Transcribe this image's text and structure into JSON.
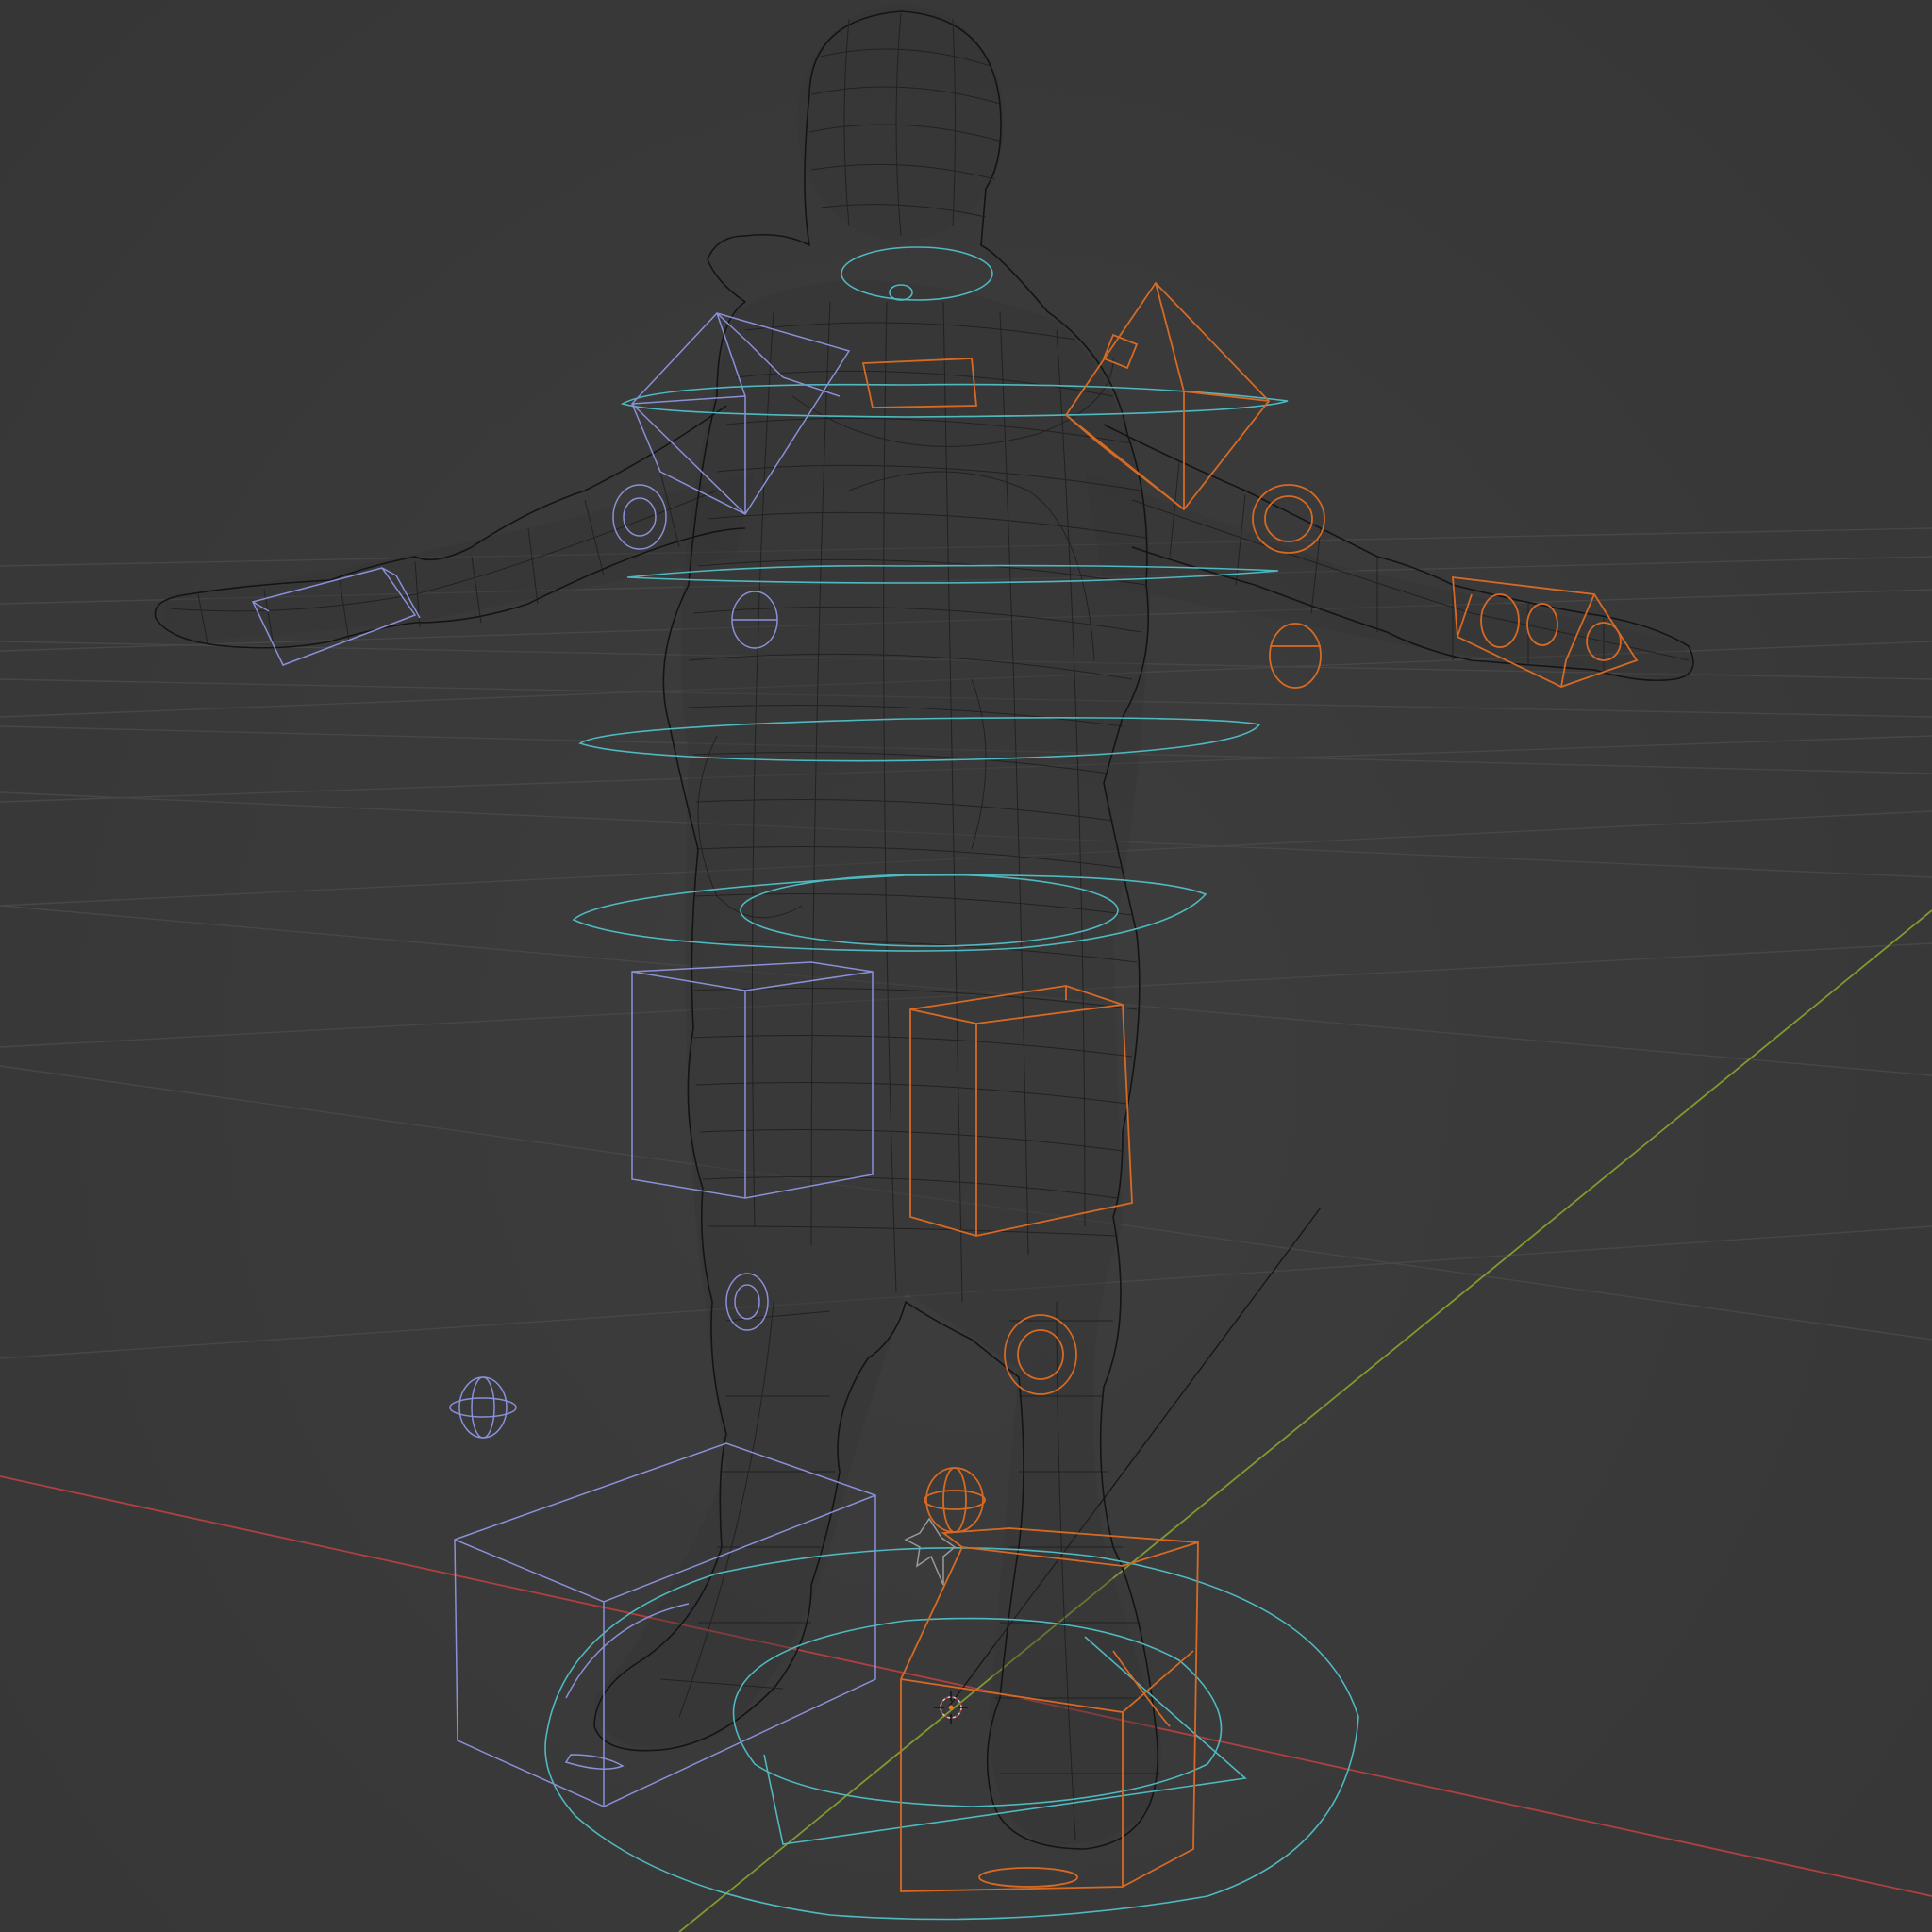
{
  "viewport": {
    "background": "#3a3a3a",
    "grid_color": "#474747",
    "axis_x_color": "#b04040",
    "axis_y_color": "#7f9a2e",
    "mesh_color": "#141414"
  },
  "rig": {
    "colors": {
      "center": "#4fb8c0",
      "left": "#8a90d8",
      "right": "#d66a24"
    },
    "controls": {
      "center": [
        "root-ring",
        "torso-ring-chest",
        "torso-ring-upper",
        "torso-ring-mid",
        "torso-ring-hip",
        "head-ring",
        "neck-ring"
      ],
      "left": [
        "shoulder-cube-left",
        "hand-box-left",
        "elbow-circle-left",
        "thigh-box-left",
        "knee-circle-left",
        "foot-box-left",
        "pole-target-left",
        "arm-pole-left"
      ],
      "right": [
        "shoulder-cube-right",
        "hand-box-right",
        "elbow-circle-right",
        "thigh-box-right",
        "knee-circle-right",
        "foot-box-right",
        "pole-target-right",
        "arm-pole-right"
      ]
    }
  },
  "icons": [
    "3d-cursor-icon",
    "light-empty-icon",
    "camera-line"
  ]
}
